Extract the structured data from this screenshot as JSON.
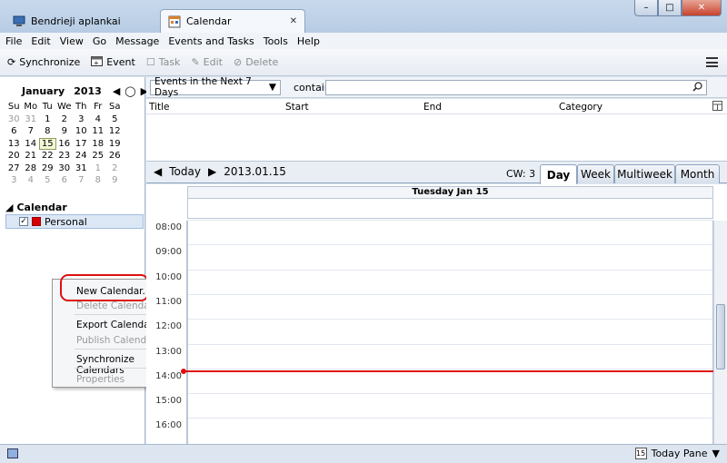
{
  "tabs": [
    {
      "label": "Bendrieji aplankai",
      "active": false
    },
    {
      "label": "Calendar",
      "active": true
    }
  ],
  "window_buttons": {
    "minimize": "–",
    "maximize": "□",
    "close": "✕"
  },
  "menu": [
    "File",
    "Edit",
    "View",
    "Go",
    "Message",
    "Events and Tasks",
    "Tools",
    "Help"
  ],
  "toolbar": {
    "synchronize": "Synchronize",
    "event": "Event",
    "task": "Task",
    "edit": "Edit",
    "delete": "Delete"
  },
  "minical": {
    "month": "January",
    "year": "2013",
    "weekdays": [
      "Su",
      "Mo",
      "Tu",
      "We",
      "Th",
      "Fr",
      "Sa"
    ],
    "weeks": [
      [
        "30",
        "31",
        "1",
        "2",
        "3",
        "4",
        "5"
      ],
      [
        "6",
        "7",
        "8",
        "9",
        "10",
        "11",
        "12"
      ],
      [
        "13",
        "14",
        "15",
        "16",
        "17",
        "18",
        "19"
      ],
      [
        "20",
        "21",
        "22",
        "23",
        "24",
        "25",
        "26"
      ],
      [
        "27",
        "28",
        "29",
        "30",
        "31",
        "1",
        "2"
      ],
      [
        "3",
        "4",
        "5",
        "6",
        "7",
        "8",
        "9"
      ]
    ],
    "today": "15"
  },
  "calendar_section": {
    "title": "Calendar",
    "items": [
      {
        "name": "Personal",
        "checked": true,
        "color": "#d60000"
      }
    ]
  },
  "context_menu": {
    "new_calendar": "New Calendar...",
    "delete_calendar": "Delete Calendar",
    "export_calendar": "Export Calendar...",
    "publish_calendar": "Publish Calendar...",
    "synchronize_calendars": "Synchronize Calendars",
    "properties": "Properties"
  },
  "filter": {
    "range": "Events in the Next 7 Days",
    "contain": "contain",
    "search_value": ""
  },
  "list_columns": [
    "Title",
    "Start",
    "End",
    "Category"
  ],
  "dayview": {
    "today_label": "Today",
    "date": "2013.01.15",
    "cw": "CW: 3",
    "view_tabs": [
      "Day",
      "Week",
      "Multiweek",
      "Month"
    ],
    "active_view": "Day",
    "header": "Tuesday Jan 15",
    "times": [
      "08:00",
      "09:00",
      "10:00",
      "11:00",
      "12:00",
      "13:00",
      "14:00",
      "15:00",
      "16:00"
    ]
  },
  "status": {
    "today_pane": "Today Pane",
    "today_num": "15"
  }
}
